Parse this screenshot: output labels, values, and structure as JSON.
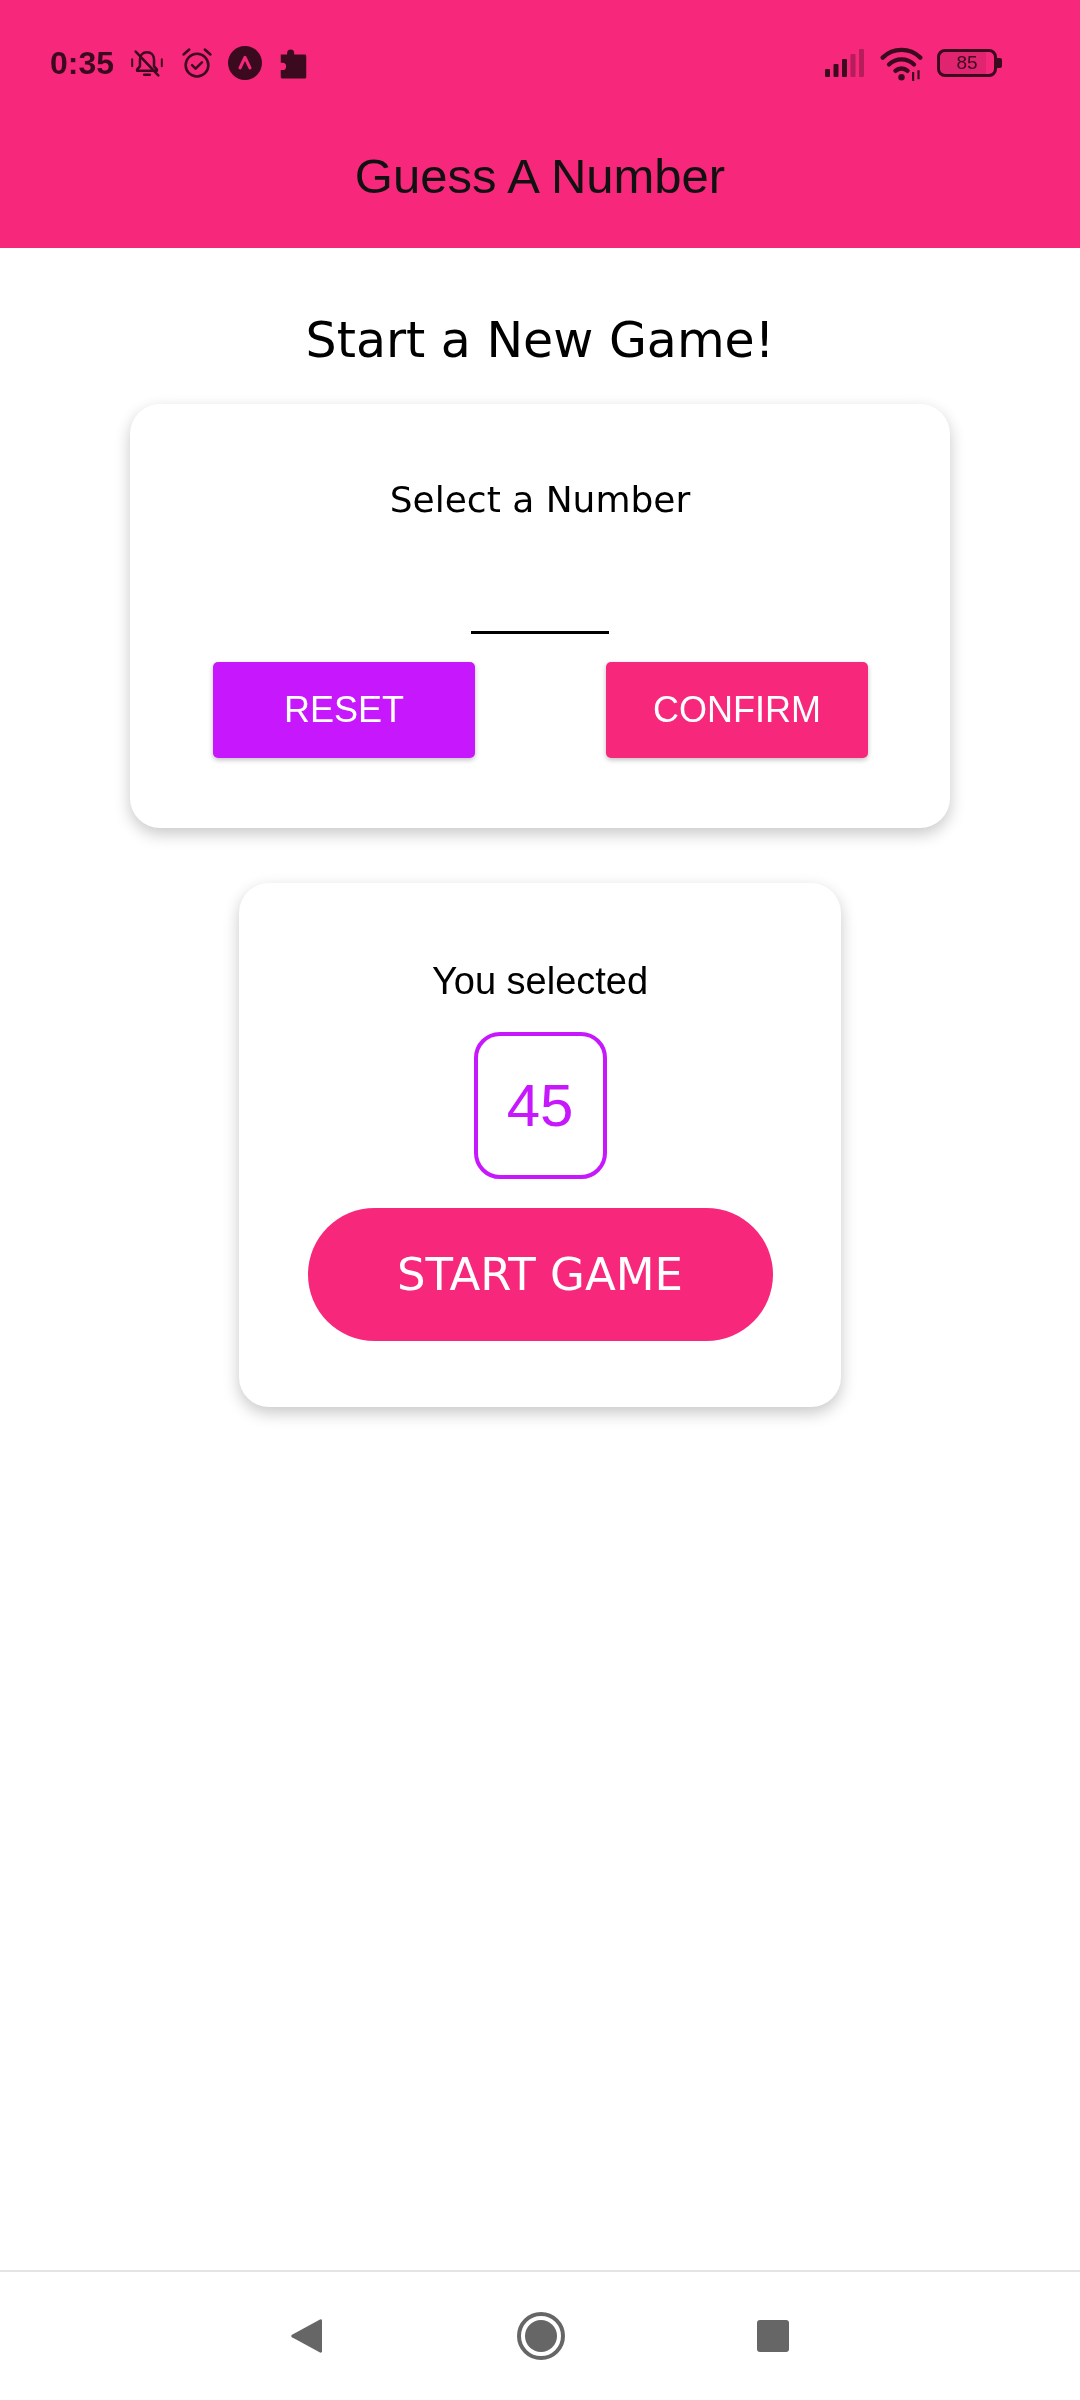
{
  "status_bar": {
    "time": "0:35",
    "battery": "85"
  },
  "header": {
    "title": "Guess A Number"
  },
  "screen_title": "Start a New Game!",
  "input_card": {
    "label": "Select a Number",
    "buttons": [
      {
        "label": "RESET",
        "color": "#c717fc"
      },
      {
        "label": "CONFIRM",
        "color": "#f7287b"
      }
    ]
  },
  "summary_card": {
    "label": "You selected",
    "number": "45",
    "button": "START GAME"
  }
}
